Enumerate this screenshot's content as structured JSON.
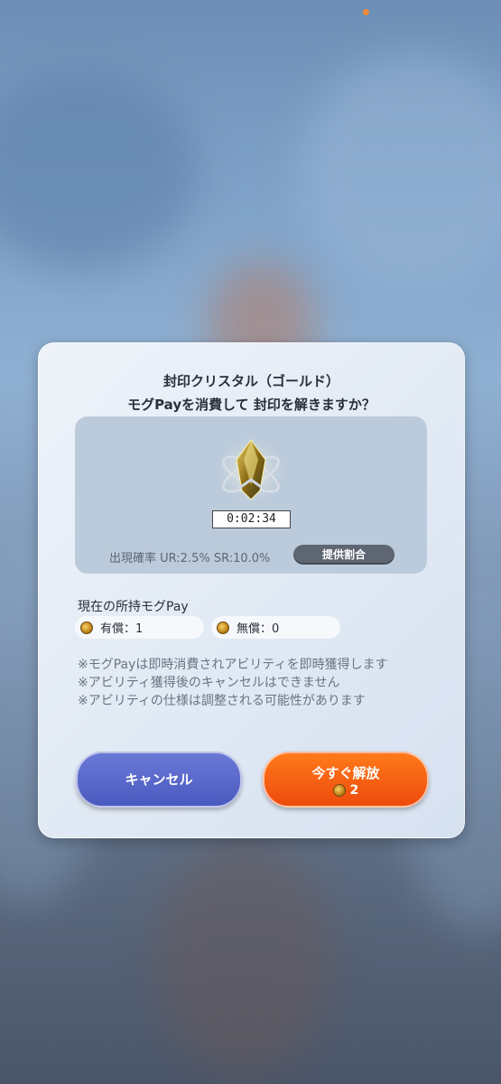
{
  "dialog": {
    "title_line1": "封印クリスタル（ゴールド）",
    "title_line2": "モグPayを消費して 封印を解きますか？",
    "timer": "0:02:34",
    "rate_text": "出現確率 UR:2.5% SR:10.0%",
    "rate_button": "提供割合",
    "owned_title": "現在の所持モグPay",
    "paid_label": "有償：1",
    "free_label": "無償：0",
    "notes": [
      "※モグPayは即時消費されアビリティを即時獲得します",
      "※アビリティ獲得後のキャンセルはできません",
      "※アビリティの仕様は調整される可能性があります"
    ],
    "cancel_button": "キャンセル",
    "unlock_button": "今すぐ解放",
    "unlock_cost": "2"
  },
  "colors": {
    "cancel": "#4a5ac0",
    "unlock": "#ee4a0c",
    "rate_button": "#5d6672"
  },
  "icons": {
    "crystal": "gold-crystal-icon",
    "coin": "mog-coin-icon"
  }
}
